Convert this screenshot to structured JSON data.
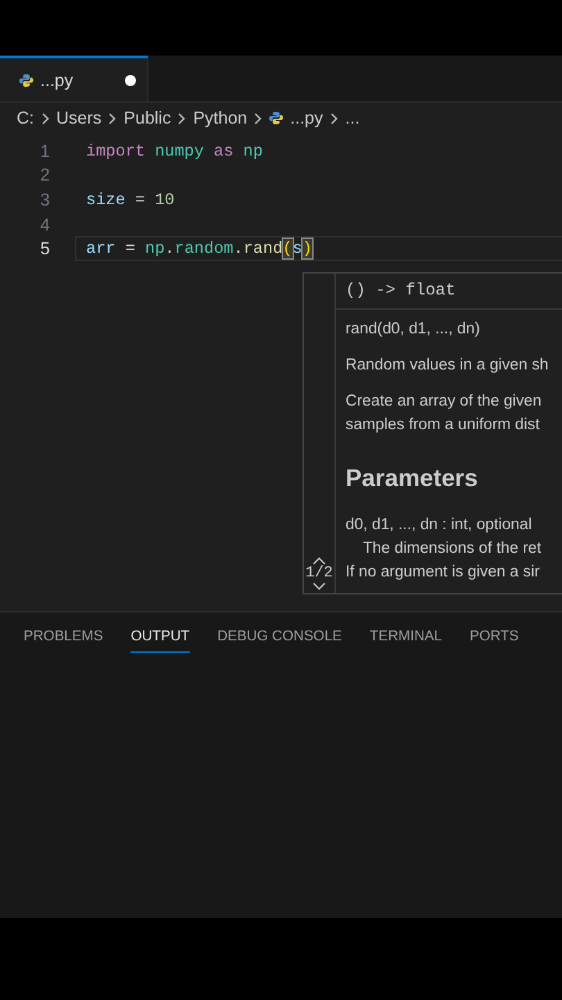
{
  "editor_tabs": [
    {
      "label": "...py",
      "selected": true,
      "modified": true
    }
  ],
  "breadcrumbs": [
    {
      "label": "C:",
      "icon": false
    },
    {
      "label": "Users",
      "icon": false
    },
    {
      "label": "Public",
      "icon": false
    },
    {
      "label": "Python",
      "icon": false
    },
    {
      "label": "...py",
      "icon": true
    },
    {
      "label": "...",
      "icon": false
    }
  ],
  "code_lines": [
    {
      "number": "1",
      "current": false,
      "tokens": [
        {
          "text": "import",
          "kind": "keyword"
        },
        {
          "text": " numpy",
          "kind": "module"
        },
        {
          "text": " as",
          "kind": "keyword"
        },
        {
          "text": " np",
          "kind": "module"
        }
      ]
    },
    {
      "number": "2",
      "current": false
    },
    {
      "number": "3",
      "current": false,
      "tokens": [
        {
          "text": "size",
          "kind": "variable"
        },
        {
          "text": " = ",
          "kind": "plain"
        },
        {
          "text": "10",
          "kind": "number"
        }
      ]
    },
    {
      "number": "4",
      "current": false
    },
    {
      "number": "5",
      "current": true,
      "tokens": [
        {
          "text": "arr",
          "kind": "variable"
        },
        {
          "text": " = ",
          "kind": "plain"
        },
        {
          "text": "np",
          "kind": "module"
        },
        {
          "text": ".",
          "kind": "plain"
        },
        {
          "text": "random",
          "kind": "module"
        },
        {
          "text": ".",
          "kind": "plain"
        },
        {
          "text": "rand",
          "kind": "function"
        },
        {
          "text": "(",
          "kind": "bracket-match"
        },
        {
          "text": "s",
          "kind": "variable"
        },
        {
          "text": ")",
          "kind": "bracket-match"
        }
      ]
    }
  ],
  "hover": {
    "signature": "() -> float",
    "pager": "1/2",
    "blocks": [
      {
        "kind": "text",
        "text": "rand(d0, d1, ..., dn)"
      },
      {
        "kind": "text",
        "text": "Random values in a given sh"
      },
      {
        "kind": "text",
        "text": "Create an array of the given\nsamples from a uniform dist"
      },
      {
        "kind": "heading",
        "text": "Parameters"
      },
      {
        "kind": "text",
        "text": "d0, d1, ..., dn : int, optional\n    The dimensions of the ret\nIf no argument is given a sir"
      }
    ]
  },
  "panel_tabs": [
    {
      "label": "PROBLEMS",
      "selected": false
    },
    {
      "label": "OUTPUT",
      "selected": true
    },
    {
      "label": "DEBUG CONSOLE",
      "selected": false
    },
    {
      "label": "TERMINAL",
      "selected": false
    },
    {
      "label": "PORTS",
      "selected": false
    }
  ]
}
